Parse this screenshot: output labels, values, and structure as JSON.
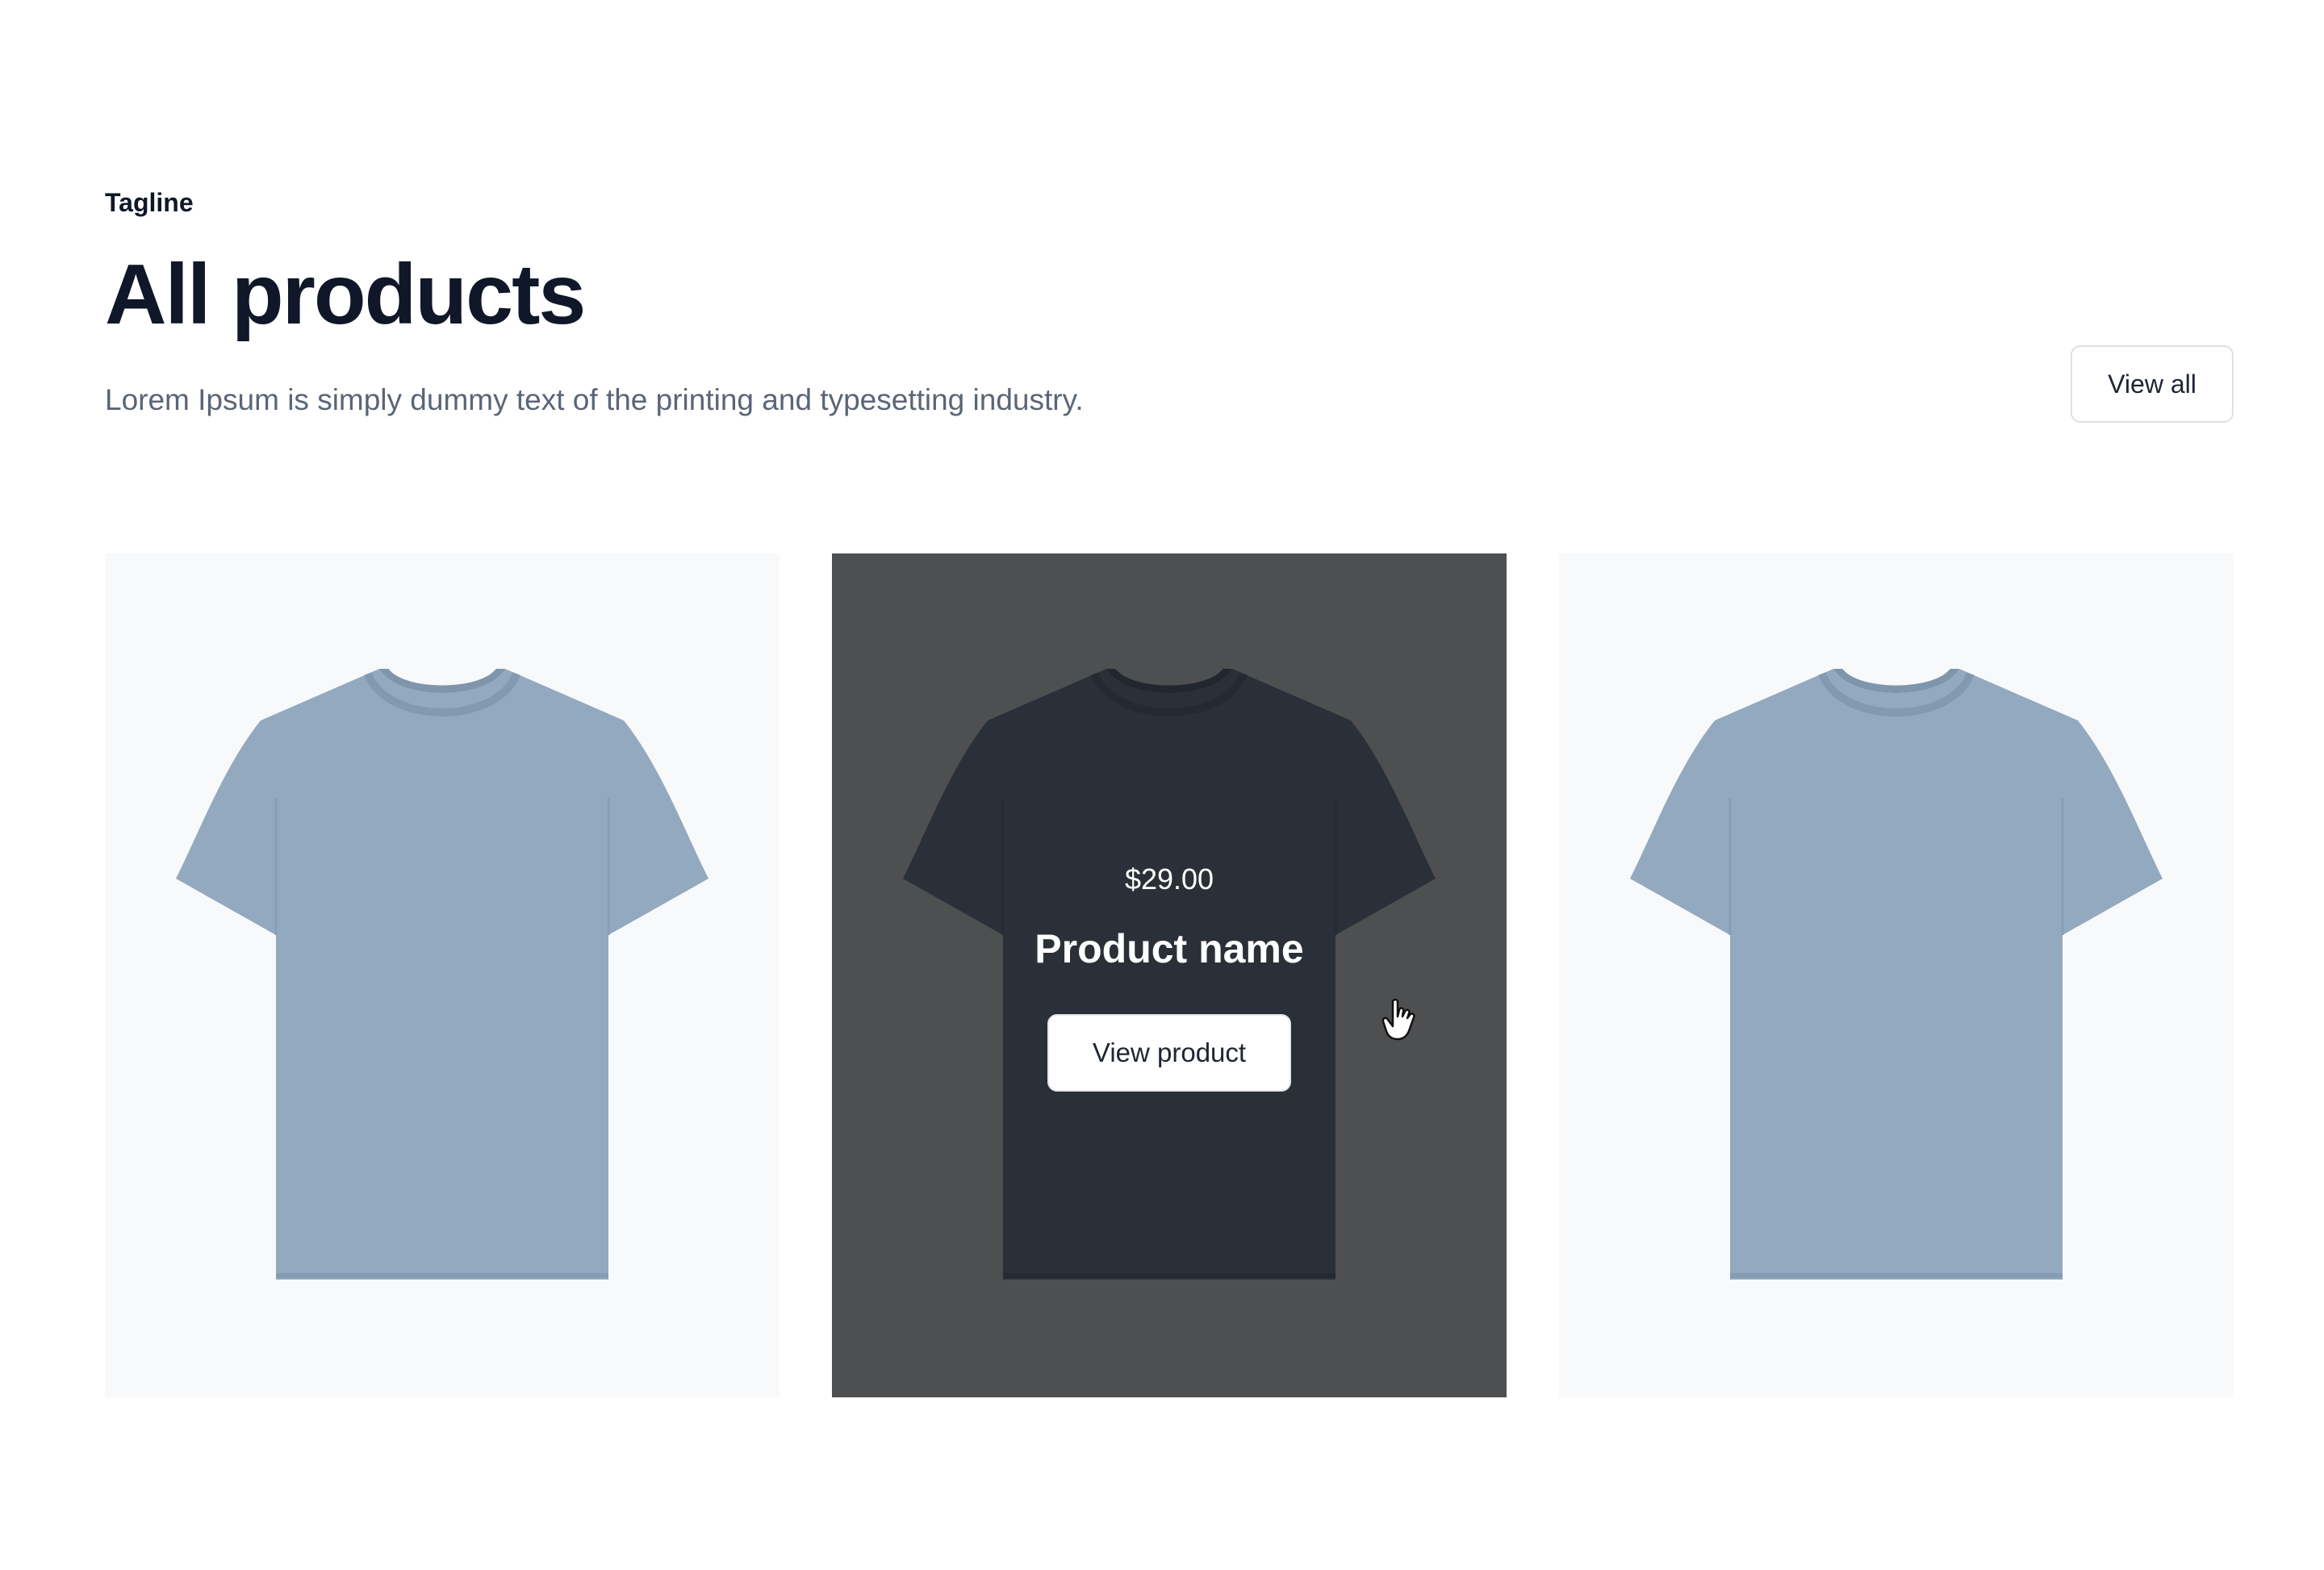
{
  "header": {
    "tagline": "Tagline",
    "title": "All products",
    "description": "Lorem Ipsum is simply dummy text of the printing and typesetting industry.",
    "view_all_label": "View all"
  },
  "products": [
    {
      "shirt_color": "#93a9bf",
      "state": "default"
    },
    {
      "shirt_color": "#2b3038",
      "state": "hover",
      "price": "$29.00",
      "name": "Product name",
      "view_label": "View product"
    },
    {
      "shirt_color": "#93a9bf",
      "state": "default"
    }
  ],
  "icons": {
    "cursor": "hand-pointer-icon"
  },
  "colors": {
    "heading": "#0f1729",
    "body_text": "#5b6577",
    "card_background": "#f8f9fb",
    "hover_overlay": "#4e4f51"
  }
}
